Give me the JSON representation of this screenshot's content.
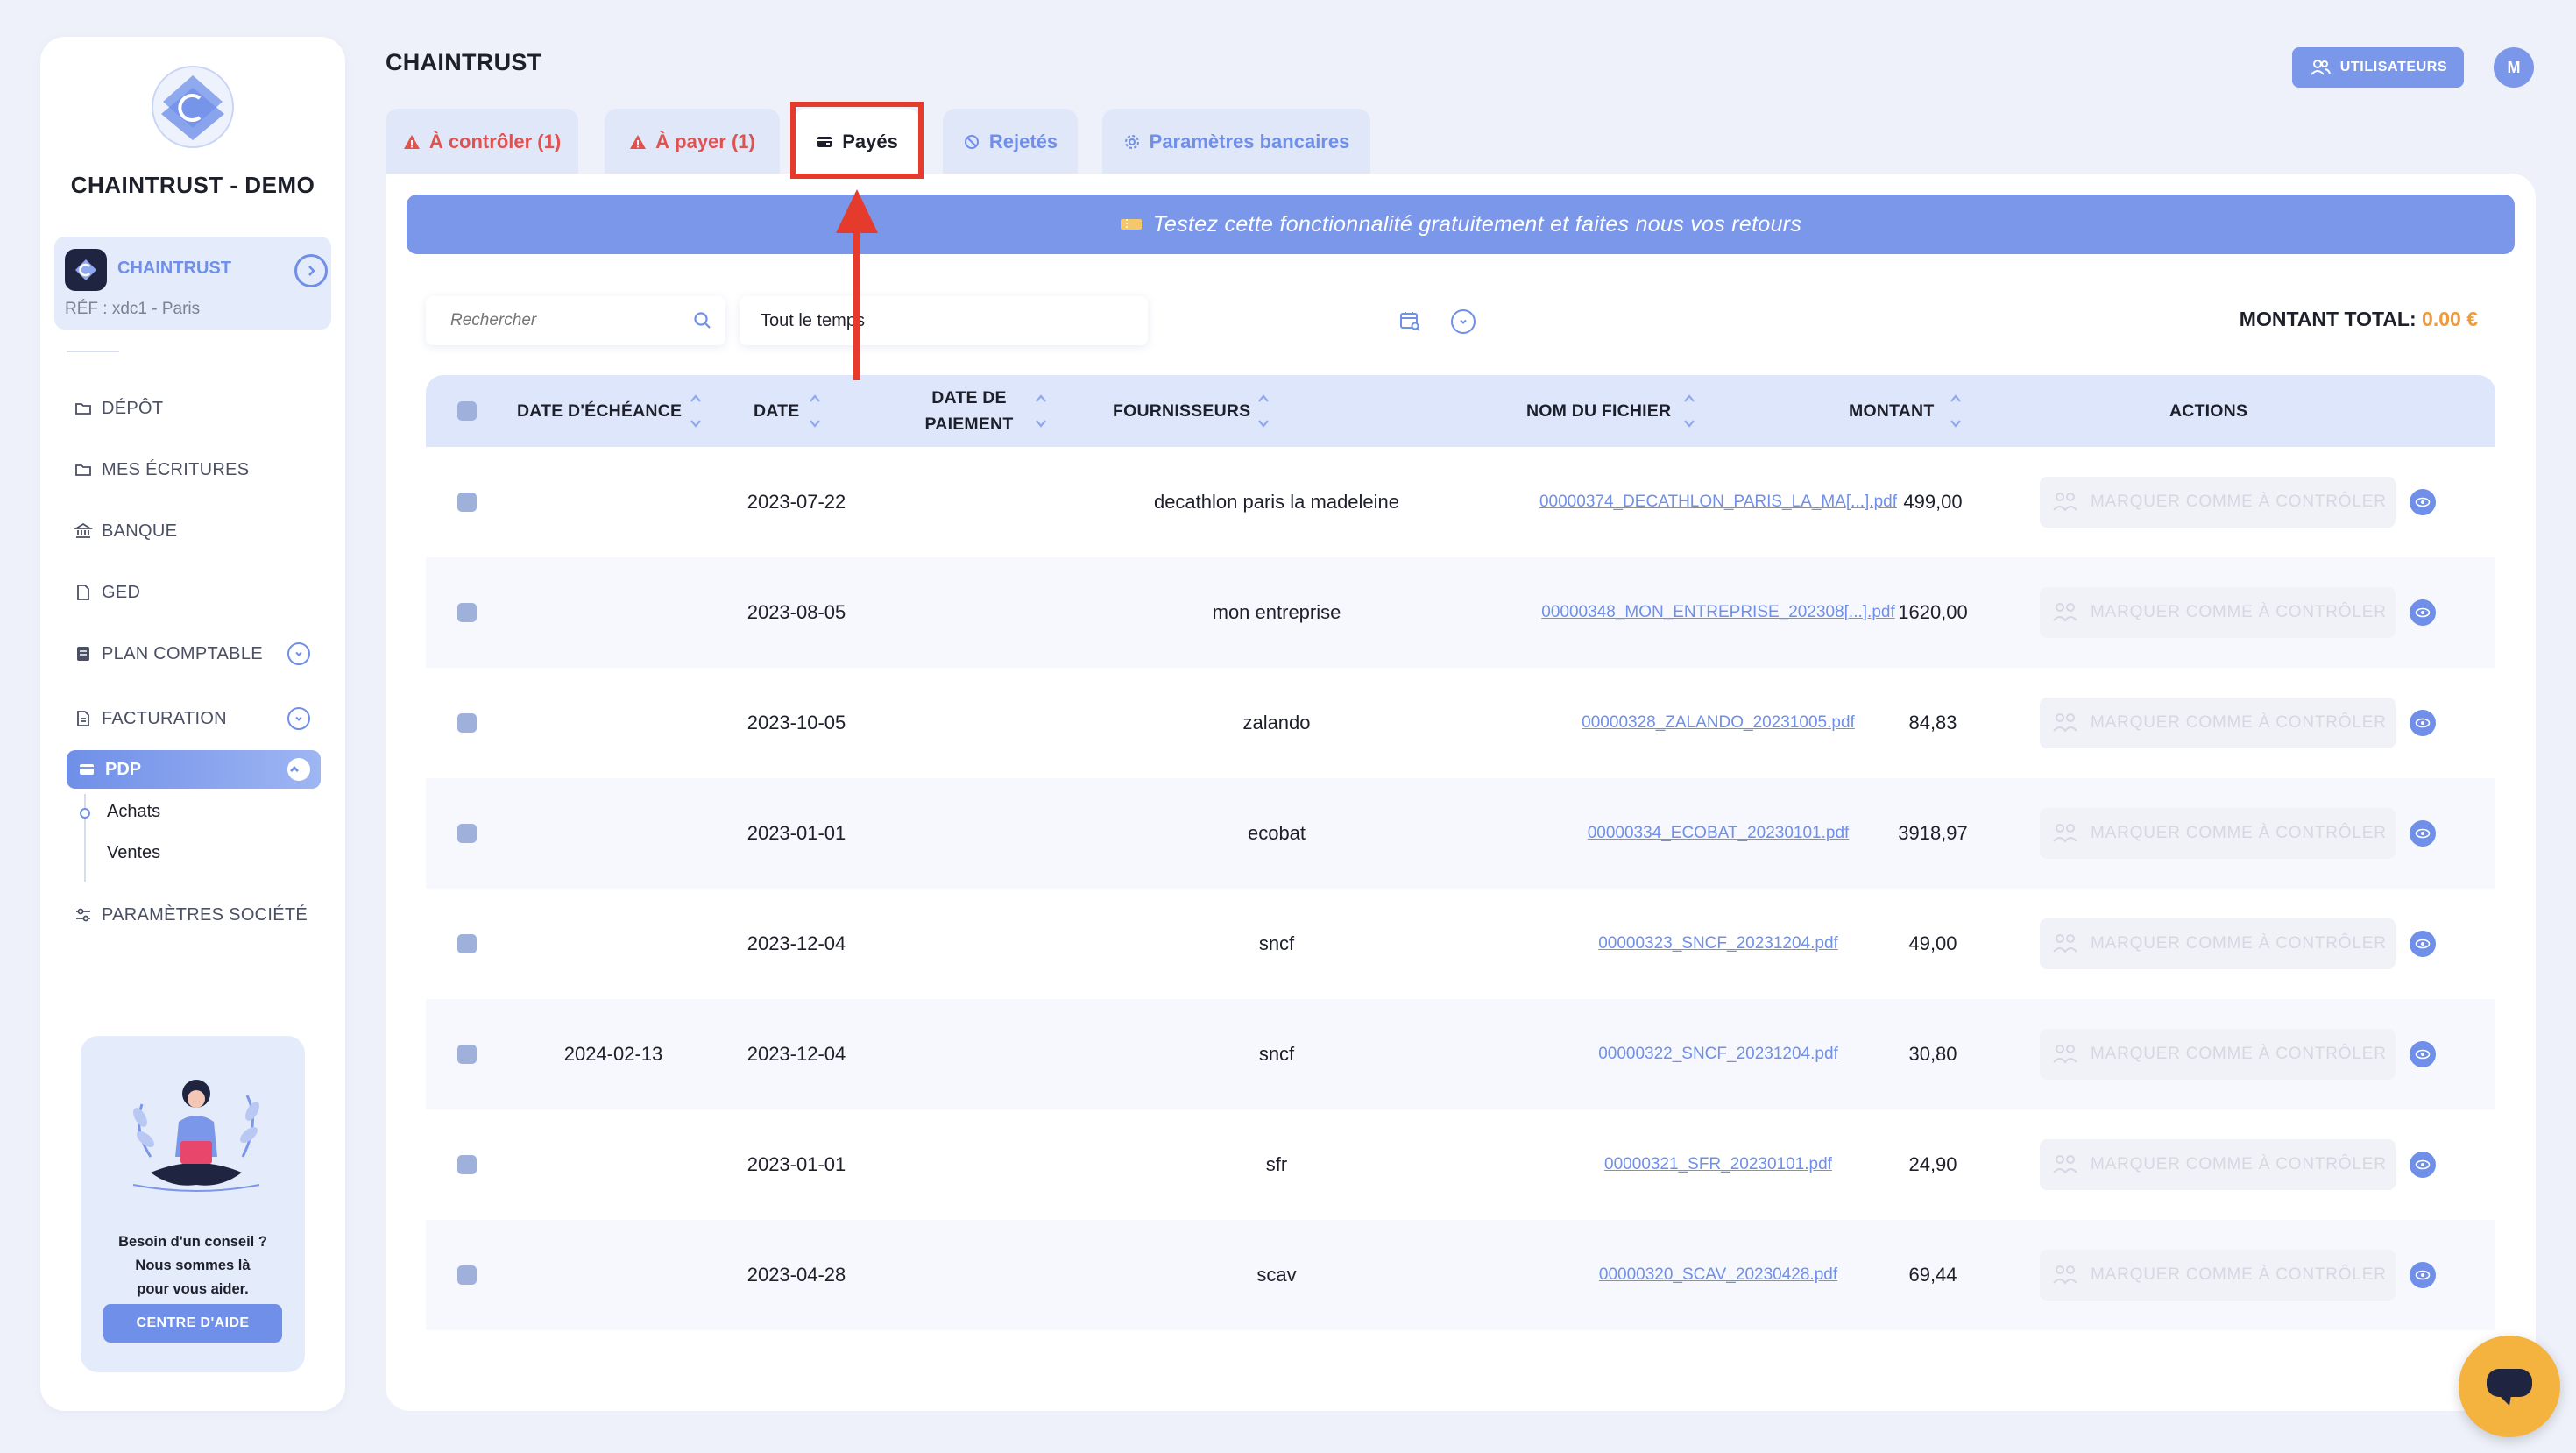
{
  "sidebar": {
    "brand": "CHAINTRUST - DEMO",
    "company": {
      "name": "CHAINTRUST",
      "ref": "RÉF : xdc1 - Paris"
    },
    "nav": {
      "depot": "DÉPÔT",
      "ecritures": "MES ÉCRITURES",
      "banque": "BANQUE",
      "ged": "GED",
      "plan": "PLAN COMPTABLE",
      "facturation": "FACTURATION",
      "pdp": "PDP",
      "achats": "Achats",
      "ventes": "Ventes",
      "parametres": "PARAMÈTRES SOCIÉTÉ"
    },
    "help": {
      "line1": "Besoin d'un conseil ?",
      "line2": "Nous sommes là",
      "line3": "pour vous aider.",
      "button": "CENTRE D'AIDE"
    }
  },
  "header": {
    "title": "CHAINTRUST",
    "users_button": "UTILISATEURS",
    "avatar_initial": "M"
  },
  "tabs": {
    "a_controler": "À contrôler (1)",
    "a_payer": "À payer (1)",
    "payes": "Payés",
    "rejetes": "Rejetés",
    "parametres_bancaires": "Paramètres bancaires"
  },
  "banner": "Testez cette fonctionnalité gratuitement et faites nous vos retours",
  "filters": {
    "search_placeholder": "Rechercher",
    "period": "Tout le temps"
  },
  "total": {
    "label": "MONTANT TOTAL:",
    "value": "0.00 €"
  },
  "table": {
    "headers": {
      "due_date": "DATE D'ÉCHÉANCE",
      "date": "DATE",
      "payment_date_1": "DATE DE",
      "payment_date_2": "PAIEMENT",
      "supplier": "FOURNISSEURS",
      "file": "NOM DU FICHIER",
      "amount": "MONTANT",
      "actions": "ACTIONS"
    },
    "action_label": "MARQUER COMME À CONTRÔLER",
    "rows": [
      {
        "due": "",
        "date": "2023-07-22",
        "supplier": "decathlon paris la madeleine",
        "file": "00000374_DECATHLON_PARIS_LA_MA[...].pdf",
        "amount": "499,00"
      },
      {
        "due": "",
        "date": "2023-08-05",
        "supplier": "mon entreprise",
        "file": "00000348_MON_ENTREPRISE_202308[...].pdf",
        "amount": "1620,00"
      },
      {
        "due": "",
        "date": "2023-10-05",
        "supplier": "zalando",
        "file": "00000328_ZALANDO_20231005.pdf",
        "amount": "84,83"
      },
      {
        "due": "",
        "date": "2023-01-01",
        "supplier": "ecobat",
        "file": "00000334_ECOBAT_20230101.pdf",
        "amount": "3918,97"
      },
      {
        "due": "",
        "date": "2023-12-04",
        "supplier": "sncf",
        "file": "00000323_SNCF_20231204.pdf",
        "amount": "49,00"
      },
      {
        "due": "2024-02-13",
        "date": "2023-12-04",
        "supplier": "sncf",
        "file": "00000322_SNCF_20231204.pdf",
        "amount": "30,80"
      },
      {
        "due": "",
        "date": "2023-01-01",
        "supplier": "sfr",
        "file": "00000321_SFR_20230101.pdf",
        "amount": "24,90"
      },
      {
        "due": "",
        "date": "2023-04-28",
        "supplier": "scav",
        "file": "00000320_SCAV_20230428.pdf",
        "amount": "69,44"
      }
    ]
  },
  "colors": {
    "accent": "#6f8fe8",
    "warning": "#e0524f",
    "total_amount": "#f09a3a",
    "annotation": "#e43b2d",
    "chat": "#f4b33f"
  }
}
